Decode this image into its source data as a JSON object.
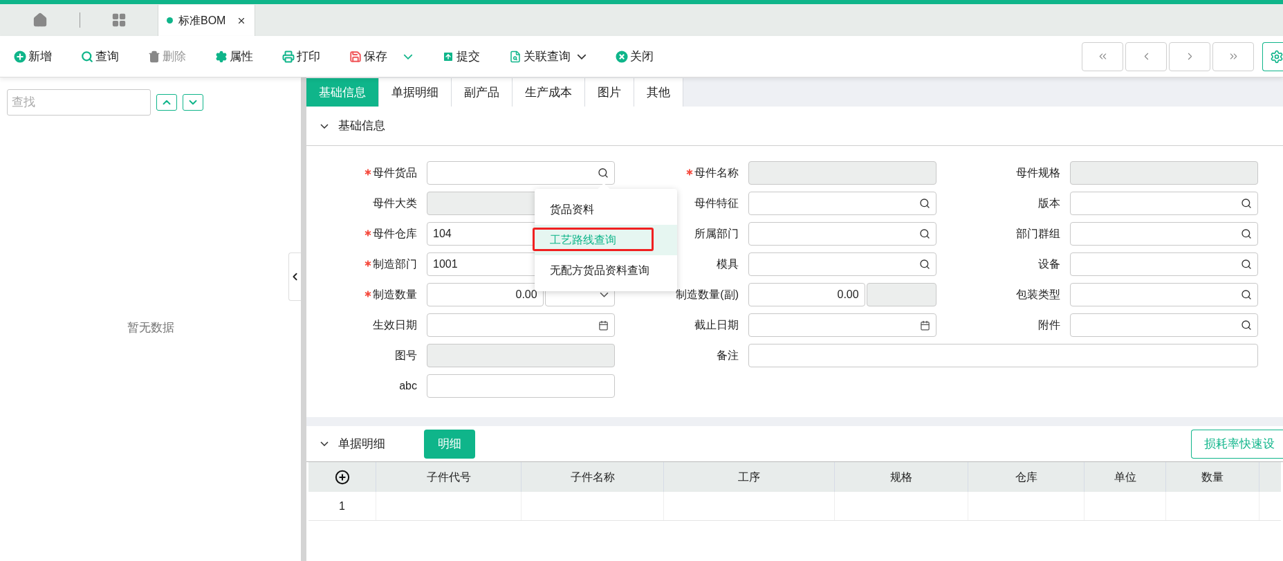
{
  "tab_bar": {
    "tabs": [
      {
        "label": "标准BOM",
        "selected": true
      }
    ]
  },
  "toolbar": {
    "items": [
      {
        "kind": "add",
        "label": "新增",
        "disabled": false,
        "has_menu": false
      },
      {
        "kind": "search",
        "label": "查询",
        "disabled": false,
        "has_menu": false
      },
      {
        "kind": "delete",
        "label": "删除",
        "disabled": true,
        "has_menu": false
      },
      {
        "kind": "settings",
        "label": "属性",
        "disabled": false,
        "has_menu": false
      },
      {
        "kind": "print",
        "label": "打印",
        "disabled": false,
        "has_menu": false
      },
      {
        "kind": "save",
        "label": "保存",
        "disabled": false,
        "has_menu": true
      },
      {
        "kind": "submit",
        "label": "提交",
        "disabled": false,
        "has_menu": false
      },
      {
        "kind": "linked",
        "label": "关联查询",
        "disabled": false,
        "has_menu": true
      },
      {
        "kind": "close",
        "label": "关闭",
        "disabled": false,
        "has_menu": false
      }
    ]
  },
  "sidebar": {
    "search": {
      "placeholder": "查找"
    },
    "empty_text": "暂无数据"
  },
  "tabs": [
    {
      "label": "基础信息",
      "selected": true
    },
    {
      "label": "单据明细",
      "selected": false
    },
    {
      "label": "副产品",
      "selected": false
    },
    {
      "label": "生产成本",
      "selected": false
    },
    {
      "label": "图片",
      "selected": false
    },
    {
      "label": "其他",
      "selected": false
    }
  ],
  "basic_section": {
    "title": "基础信息",
    "expanded": true,
    "fields": [
      {
        "label": "母件货品",
        "required": true,
        "kind": "lookup"
      },
      {
        "label": "母件名称",
        "required": true,
        "kind": "readonly"
      },
      {
        "label": "母件规格",
        "required": false,
        "kind": "readonly"
      },
      {
        "label": "母件大类",
        "required": false,
        "kind": "readonly"
      },
      {
        "label": "母件特征",
        "required": false,
        "kind": "lookup"
      },
      {
        "label": "版本",
        "required": false,
        "kind": "lookup"
      },
      {
        "label": "母件仓库",
        "required": true,
        "kind": "lookup",
        "value": "104"
      },
      {
        "label": "所属部门",
        "required": false,
        "kind": "lookup"
      },
      {
        "label": "部门群组",
        "required": false,
        "kind": "lookup"
      },
      {
        "label": "制造部门",
        "required": true,
        "kind": "lookup",
        "value": "1001"
      },
      {
        "label": "模具",
        "required": false,
        "kind": "lookup"
      },
      {
        "label": "设备",
        "required": false,
        "kind": "lookup"
      },
      {
        "label": "制造数量",
        "required": true,
        "kind": "qty_select",
        "value": "0.00"
      },
      {
        "label": "制造数量(副)",
        "required": false,
        "kind": "qty_readonly",
        "value": "0.00"
      },
      {
        "label": "包装类型",
        "required": false,
        "kind": "lookup"
      },
      {
        "label": "生效日期",
        "required": false,
        "kind": "date"
      },
      {
        "label": "截止日期",
        "required": false,
        "kind": "date"
      },
      {
        "label": "附件",
        "required": false,
        "kind": "lookup"
      },
      {
        "label": "图号",
        "required": false,
        "kind": "readonly"
      },
      {
        "label": "备注",
        "required": false,
        "kind": "wide"
      },
      {
        "label": "abc",
        "required": false,
        "kind": "text"
      }
    ]
  },
  "lookup_menu": {
    "items": [
      {
        "label": "货品资料",
        "selected": false,
        "annotated": false
      },
      {
        "label": "工艺路线查询",
        "selected": true,
        "annotated": true
      },
      {
        "label": "无配方货品资料查询",
        "selected": false,
        "annotated": false
      }
    ]
  },
  "detail_section": {
    "title": "单据明细",
    "expanded": true,
    "detail_button": "明细",
    "quick_button": "损耗率快速设",
    "table": {
      "columns": [
        "子件代号",
        "子件名称",
        "工序",
        "规格",
        "仓库",
        "单位",
        "数量"
      ],
      "rows": [
        {
          "row_number": "1"
        }
      ]
    }
  }
}
